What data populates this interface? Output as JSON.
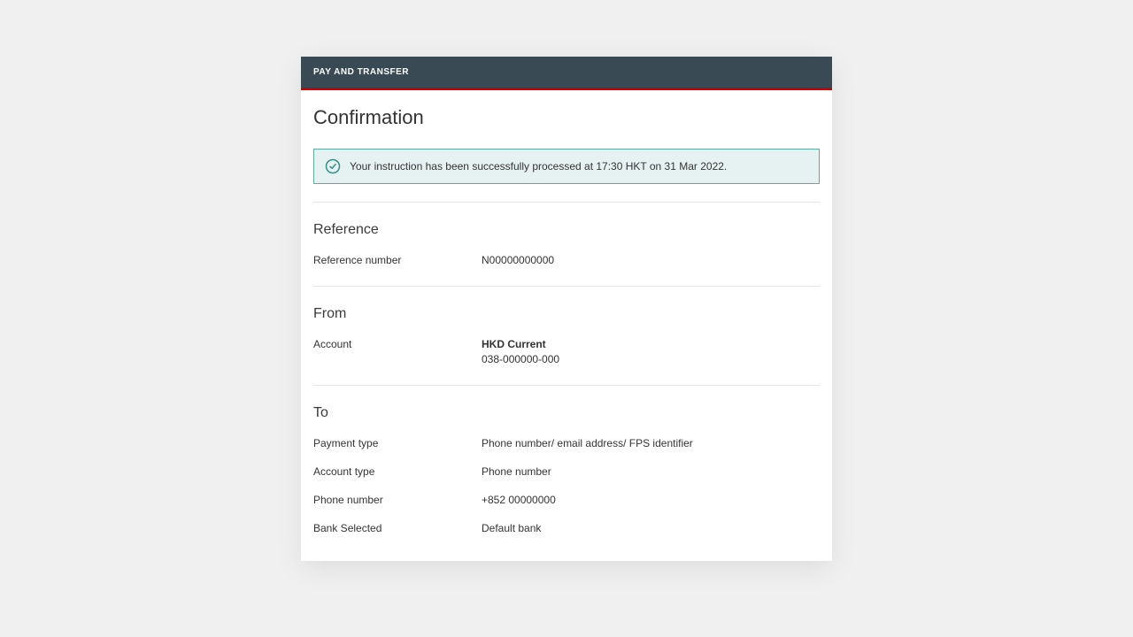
{
  "header": {
    "title": "PAY AND TRANSFER"
  },
  "page": {
    "title": "Confirmation"
  },
  "notification": {
    "message": "Your instruction has been successfully processed at 17:30 HKT on 31 Mar 2022."
  },
  "sections": {
    "reference": {
      "title": "Reference",
      "reference_number_label": "Reference number",
      "reference_number_value": "N00000000000"
    },
    "from": {
      "title": "From",
      "account_label": "Account",
      "account_name": "HKD Current",
      "account_number": "038-000000-000"
    },
    "to": {
      "title": "To",
      "payment_type_label": "Payment type",
      "payment_type_value": "Phone number/ email address/ FPS identifier",
      "account_type_label": "Account type",
      "account_type_value": "Phone number",
      "phone_number_label": "Phone number",
      "phone_number_value": "+852 00000000",
      "bank_selected_label": "Bank Selected",
      "bank_selected_value": "Default bank"
    }
  }
}
